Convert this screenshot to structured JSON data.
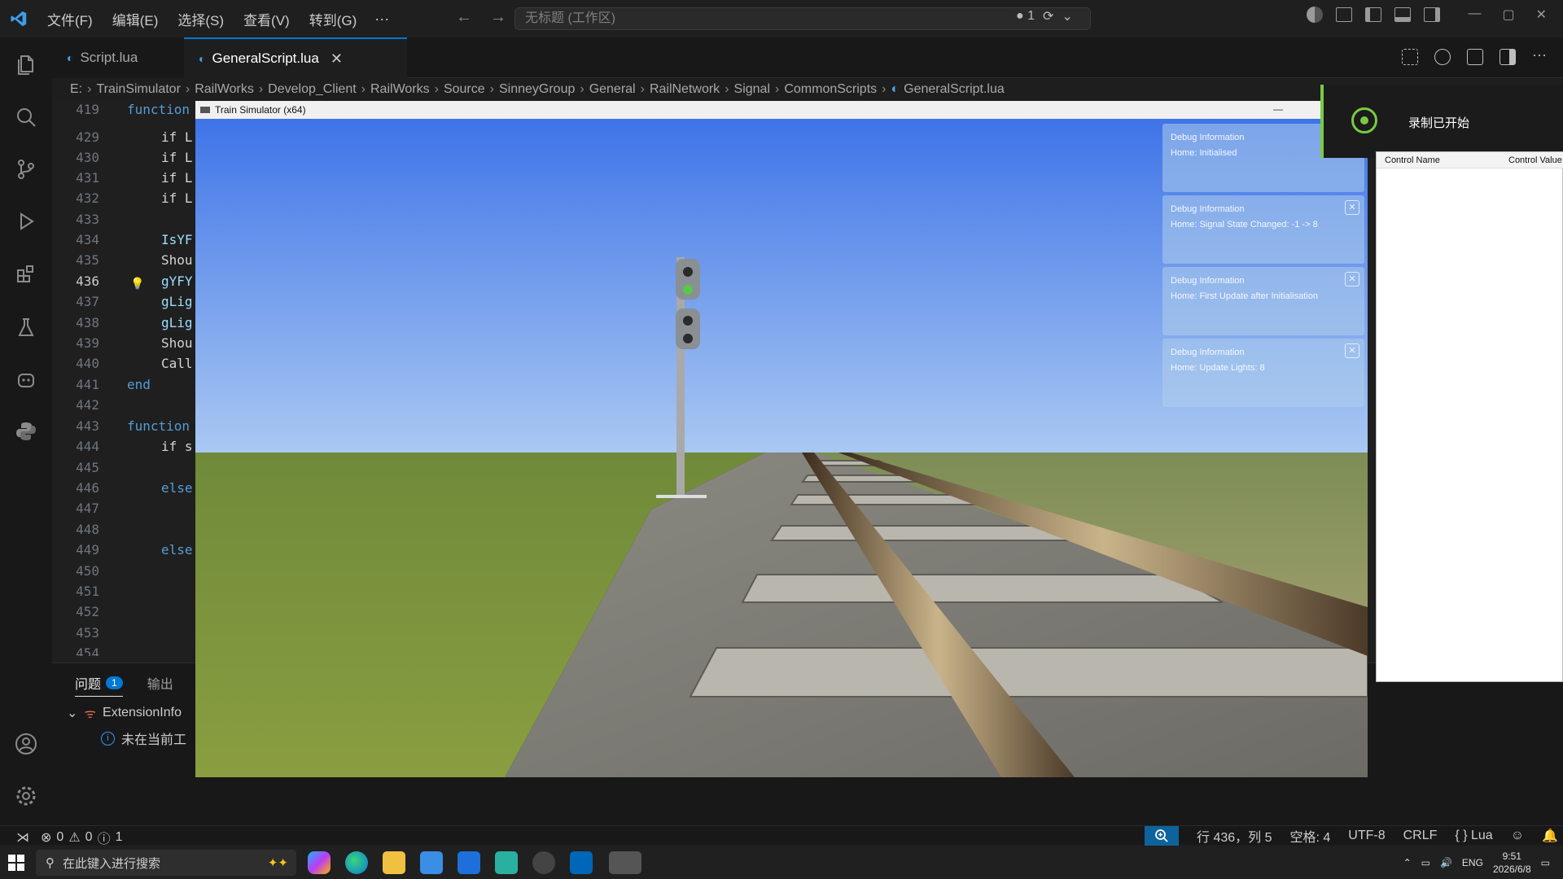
{
  "titlebar": {
    "menus": [
      "文件(F)",
      "编辑(E)",
      "选择(S)",
      "查看(V)",
      "转到(G)",
      "···"
    ],
    "search": "无标题 (工作区)",
    "indicator": "● 1"
  },
  "tabs": [
    {
      "label": "Script.lua"
    },
    {
      "label": "GeneralScript.lua",
      "close": "✕"
    }
  ],
  "breadcrumb": [
    "E:",
    "TrainSimulator",
    "RailWorks",
    "Develop_Client",
    "RailWorks",
    "Source",
    "SinneyGroup",
    "General",
    "RailNetwork",
    "Signal",
    "CommonScripts",
    "GeneralScript.lua"
  ],
  "editor": {
    "lines": [
      {
        "n": "419",
        "code": "function"
      },
      {
        "n": "429",
        "code": "if L"
      },
      {
        "n": "430",
        "code": "if L"
      },
      {
        "n": "431",
        "code": "if L"
      },
      {
        "n": "432",
        "code": "if L"
      },
      {
        "n": "433",
        "code": ""
      },
      {
        "n": "434",
        "code": "IsYF"
      },
      {
        "n": "435",
        "code": "Shou"
      },
      {
        "n": "436",
        "code": "gYFY"
      },
      {
        "n": "437",
        "code": "gLig"
      },
      {
        "n": "438",
        "code": "gLig"
      },
      {
        "n": "439",
        "code": "Shou"
      },
      {
        "n": "440",
        "code": "Call"
      },
      {
        "n": "441",
        "code": "end"
      },
      {
        "n": "442",
        "code": ""
      },
      {
        "n": "443",
        "code": "function"
      },
      {
        "n": "444",
        "code": "if s"
      },
      {
        "n": "445",
        "code": ""
      },
      {
        "n": "446",
        "code": "else"
      },
      {
        "n": "447",
        "code": ""
      },
      {
        "n": "448",
        "code": ""
      },
      {
        "n": "449",
        "code": "else"
      },
      {
        "n": "450",
        "code": ""
      },
      {
        "n": "451",
        "code": ""
      },
      {
        "n": "452",
        "code": ""
      },
      {
        "n": "453",
        "code": ""
      },
      {
        "n": "454",
        "code": ""
      }
    ]
  },
  "panel": {
    "tabs": {
      "problems": "问题",
      "problems_count": "1",
      "output": "输出"
    },
    "tree": {
      "group": "ExtensionInfo",
      "message": "未在当前工"
    }
  },
  "statusbar": {
    "errors": "0",
    "warnings": "0",
    "infos": "1",
    "position": "行 436，列 5",
    "spaces": "空格: 4",
    "encoding": "UTF-8",
    "eol": "CRLF",
    "language": "Lua"
  },
  "game": {
    "title": "Train Simulator (x64)",
    "debug": [
      {
        "title": "Debug Information",
        "text": "Home: Initialised"
      },
      {
        "title": "Debug Information",
        "text": "Home: Signal State Changed: -1 -> 8"
      },
      {
        "title": "Debug Information",
        "text": "Home: First Update after Initialisation"
      },
      {
        "title": "Debug Information",
        "text": "Home: Update Lights: 8"
      }
    ]
  },
  "recording": {
    "text": "录制已开始"
  },
  "side_window": {
    "col1": "Control Name",
    "col2": "Control Value"
  },
  "taskbar": {
    "search": "在此键入进行搜索",
    "lang": "ENG",
    "time": "9:51",
    "date": "2026/6/8"
  },
  "colors": {
    "accent": "#0078d4",
    "sky_top": "#3f74e8",
    "sky_bottom": "#9ec0f0",
    "grass": "#7a8f3a",
    "signal_green": "#55c94a"
  }
}
